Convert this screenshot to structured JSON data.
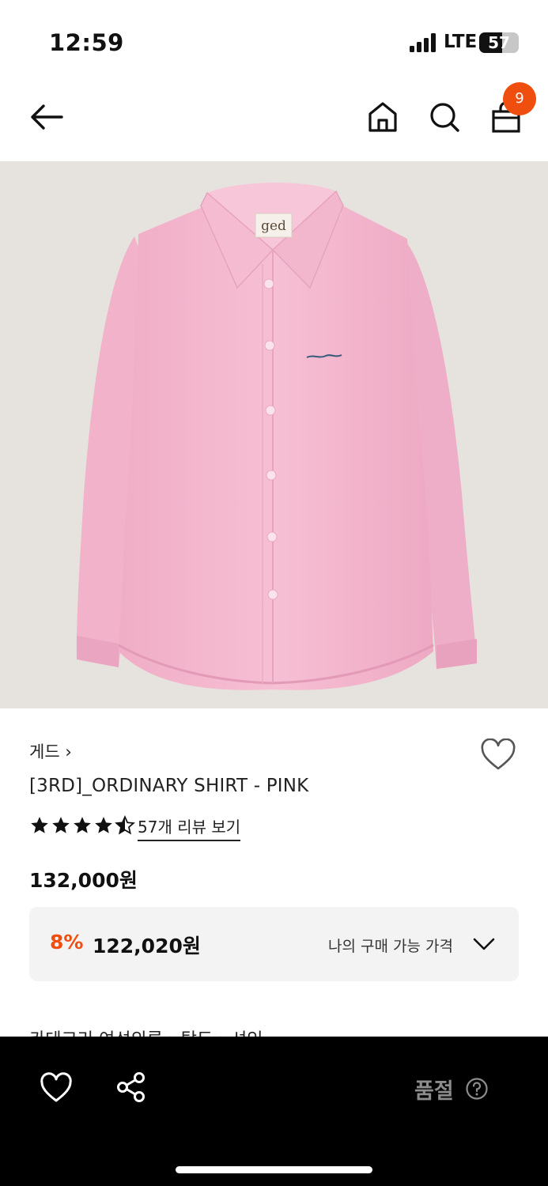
{
  "status_bar": {
    "time": "12:59",
    "network": "LTE",
    "battery": "57",
    "battery_fraction": 0.57
  },
  "nav": {
    "cart_count": "9"
  },
  "product": {
    "brand": "게드 ›",
    "name": "[3RD]_ORDINARY SHIRT - PINK",
    "rating": 4.5,
    "review_link": "57개 리뷰 보기",
    "original_price": "132,000원",
    "discount_rate": "8%",
    "discount_price": "122,020원",
    "my_price_label": "나의 구매 가능 가격",
    "label_brand_tag": "ged",
    "category_peek": "카테고리        여성의류  ›  탑도  ›  셔인"
  },
  "bottom_bar": {
    "soldout_label": "품절"
  },
  "colors": {
    "accent": "#f04e0f",
    "shirt": "#f4b8cf",
    "background_image": "#e6e3de"
  }
}
